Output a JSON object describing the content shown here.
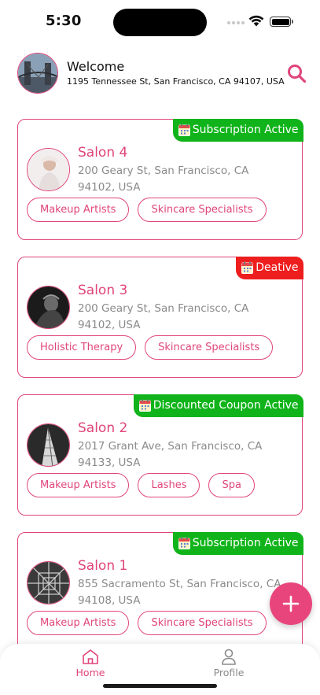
{
  "status_bar": {
    "time": "5:30"
  },
  "header": {
    "welcome": "Welcome",
    "address": "1195 Tennessee St, San Francisco, CA 94107, USA",
    "search_icon": "search-icon"
  },
  "salons": [
    {
      "name": "Salon 4",
      "address": "200 Geary St, San Francisco, CA 94102, USA",
      "badge": "Subscription Active",
      "badge_color": "#10b41a",
      "tags": [
        "Makeup Artists",
        "Skincare Specialists"
      ]
    },
    {
      "name": "Salon 3",
      "address": "200 Geary St, San Francisco, CA 94102, USA",
      "badge": "Deative",
      "badge_color": "#ef1e1e",
      "tags": [
        "Holistic Therapy",
        "Skincare Specialists"
      ]
    },
    {
      "name": "Salon 2",
      "address": "2017 Grant Ave, San Francisco, CA 94133, USA",
      "badge": "Discounted Coupon Active",
      "badge_color": "#10b41a",
      "tags": [
        "Makeup Artists",
        "Lashes",
        "Spa"
      ]
    },
    {
      "name": "Salon 1",
      "address": "855 Sacramento St, San Francisco, CA 94108, USA",
      "badge": "Subscription Active",
      "badge_color": "#10b41a",
      "tags": [
        "Makeup Artists",
        "Skincare Specialists"
      ]
    }
  ],
  "fab": {
    "icon": "plus-icon"
  },
  "tabbar": {
    "home": "Home",
    "profile": "Profile"
  },
  "colors": {
    "accent": "#e0457b",
    "active_green": "#10b41a",
    "inactive_red": "#ef1e1e"
  }
}
